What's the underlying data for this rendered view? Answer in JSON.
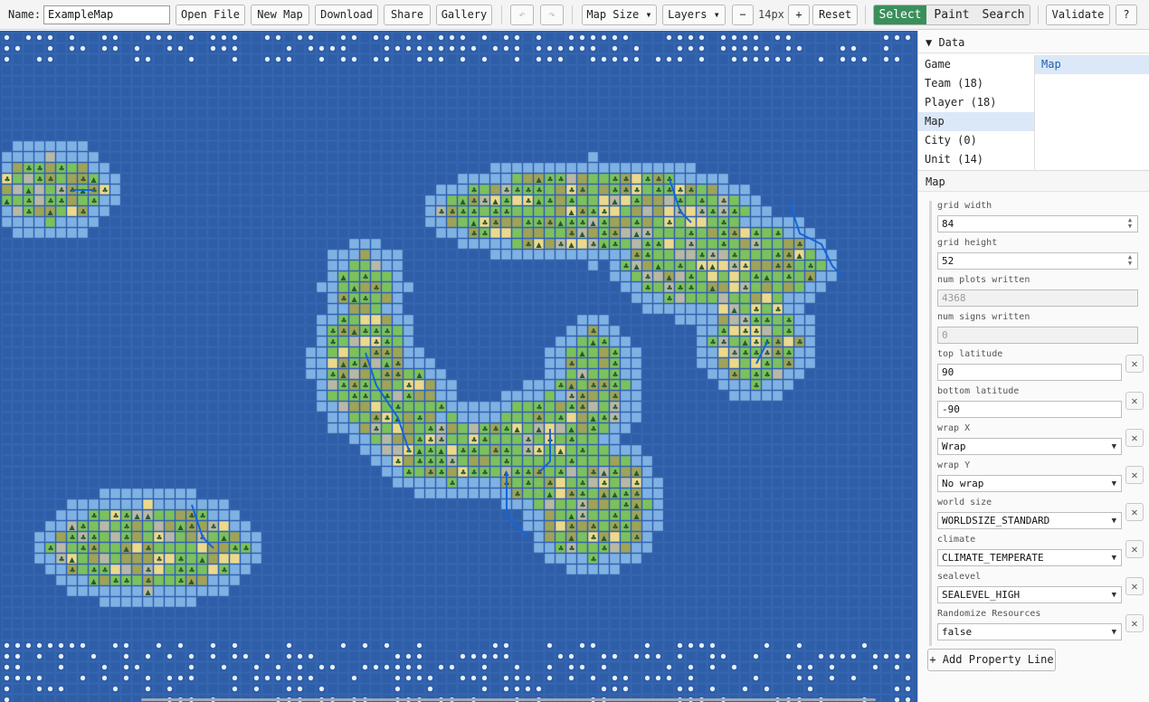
{
  "toolbar": {
    "name_label": "Name:",
    "name_value": "ExampleMap",
    "open_file": "Open File",
    "new_map": "New Map",
    "download": "Download",
    "share": "Share",
    "gallery": "Gallery",
    "undo_icon": "↶",
    "redo_icon": "↷",
    "map_size": "Map Size ▾",
    "layers": "Layers ▾",
    "zoom_out": "−",
    "zoom_level": "14px",
    "zoom_in": "+",
    "reset": "Reset",
    "modes": [
      "Select",
      "Paint",
      "Search"
    ],
    "active_mode": "Select",
    "validate": "Validate",
    "help": "?"
  },
  "map": {
    "colors": {
      "ocean": "#2f5ea8",
      "coast": "#7fb2e3",
      "grass": "#7cc15b",
      "plains": "#9fa356",
      "desert": "#ecd98a",
      "tundra": "#b8b8a6",
      "river": "#1565d8",
      "ice": "#e8f1fb"
    }
  },
  "sidebar": {
    "data_header": "▼ Data",
    "data_items": [
      "Game",
      "Team (18)",
      "Player (18)",
      "Map",
      "City (0)",
      "Unit (14)"
    ],
    "selected_item": "Map",
    "detail_items": [
      "Map"
    ],
    "map_header": "Map",
    "properties": [
      {
        "label": "grid width",
        "value": "84",
        "kind": "number",
        "removable": false
      },
      {
        "label": "grid height",
        "value": "52",
        "kind": "number",
        "removable": false
      },
      {
        "label": "num plots written",
        "value": "4368",
        "kind": "readonly",
        "removable": false
      },
      {
        "label": "num signs written",
        "value": "0",
        "kind": "readonly",
        "removable": false
      },
      {
        "label": "top latitude",
        "value": "90",
        "kind": "text",
        "removable": true
      },
      {
        "label": "bottom latitude",
        "value": "-90",
        "kind": "text",
        "removable": true
      },
      {
        "label": "wrap X",
        "value": "Wrap",
        "kind": "select",
        "removable": true
      },
      {
        "label": "wrap Y",
        "value": "No wrap",
        "kind": "select",
        "removable": true
      },
      {
        "label": "world size",
        "value": "WORLDSIZE_STANDARD",
        "kind": "select",
        "removable": true
      },
      {
        "label": "climate",
        "value": "CLIMATE_TEMPERATE",
        "kind": "select",
        "removable": true
      },
      {
        "label": "sealevel",
        "value": "SEALEVEL_HIGH",
        "kind": "select",
        "removable": true
      },
      {
        "label": "Randomize Resources",
        "value": "false",
        "kind": "select",
        "removable": true
      }
    ],
    "remove_icon": "✕",
    "add_property": "+ Add Property Line"
  }
}
